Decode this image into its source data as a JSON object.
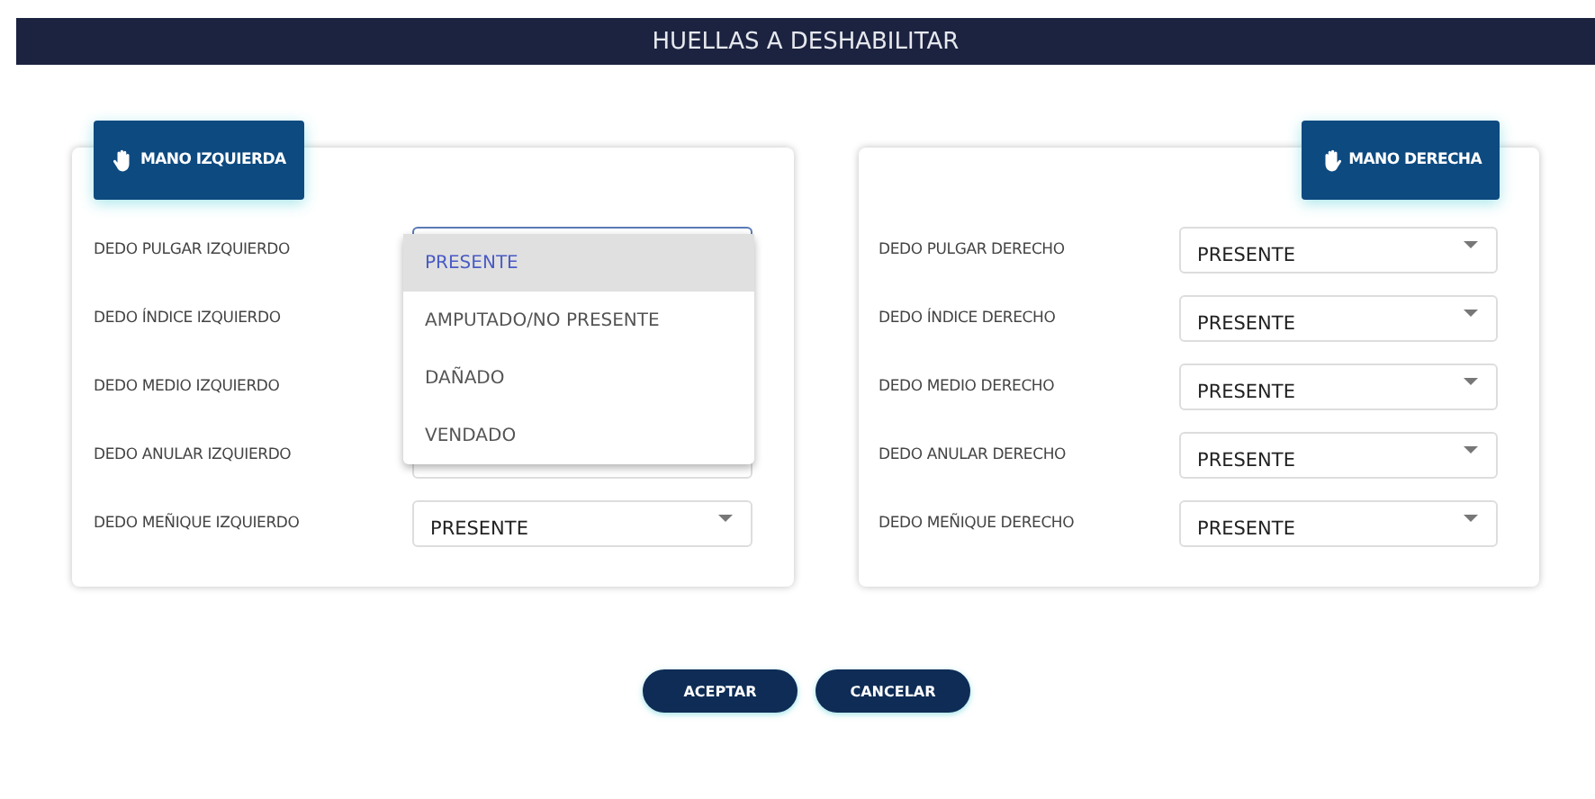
{
  "header": {
    "title": "HUELLAS A DESHABILITAR"
  },
  "hands": [
    {
      "kind": "left",
      "label": "MANO IZQUIERDA",
      "fingers": [
        {
          "label": "DEDO PULGAR IZQUIERDO",
          "open": true,
          "options": [
            {
              "label": "PRESENTE",
              "selected": true
            },
            {
              "label": "AMPUTADO/NO PRESENTE",
              "selected": false
            },
            {
              "label": "DAÑADO",
              "selected": false
            },
            {
              "label": "VENDADO",
              "selected": false
            }
          ]
        },
        {
          "label": "DEDO ÍNDICE IZQUIERDO"
        },
        {
          "label": "DEDO MEDIO IZQUIERDO"
        },
        {
          "label": "DEDO ANULAR IZQUIERDO"
        },
        {
          "label": "DEDO MEÑIQUE IZQUIERDO",
          "value": "PRESENTE"
        }
      ]
    },
    {
      "kind": "right",
      "label": "MANO DERECHA",
      "fingers": [
        {
          "label": "DEDO PULGAR DERECHO",
          "value": "PRESENTE"
        },
        {
          "label": "DEDO ÍNDICE DERECHO",
          "value": "PRESENTE"
        },
        {
          "label": "DEDO MEDIO DERECHO",
          "value": "PRESENTE"
        },
        {
          "label": "DEDO ANULAR DERECHO",
          "value": "PRESENTE"
        },
        {
          "label": "DEDO MEÑIQUE DERECHO",
          "value": "PRESENTE"
        }
      ]
    }
  ],
  "buttons": [
    "ACEPTAR",
    "CANCELAR"
  ]
}
